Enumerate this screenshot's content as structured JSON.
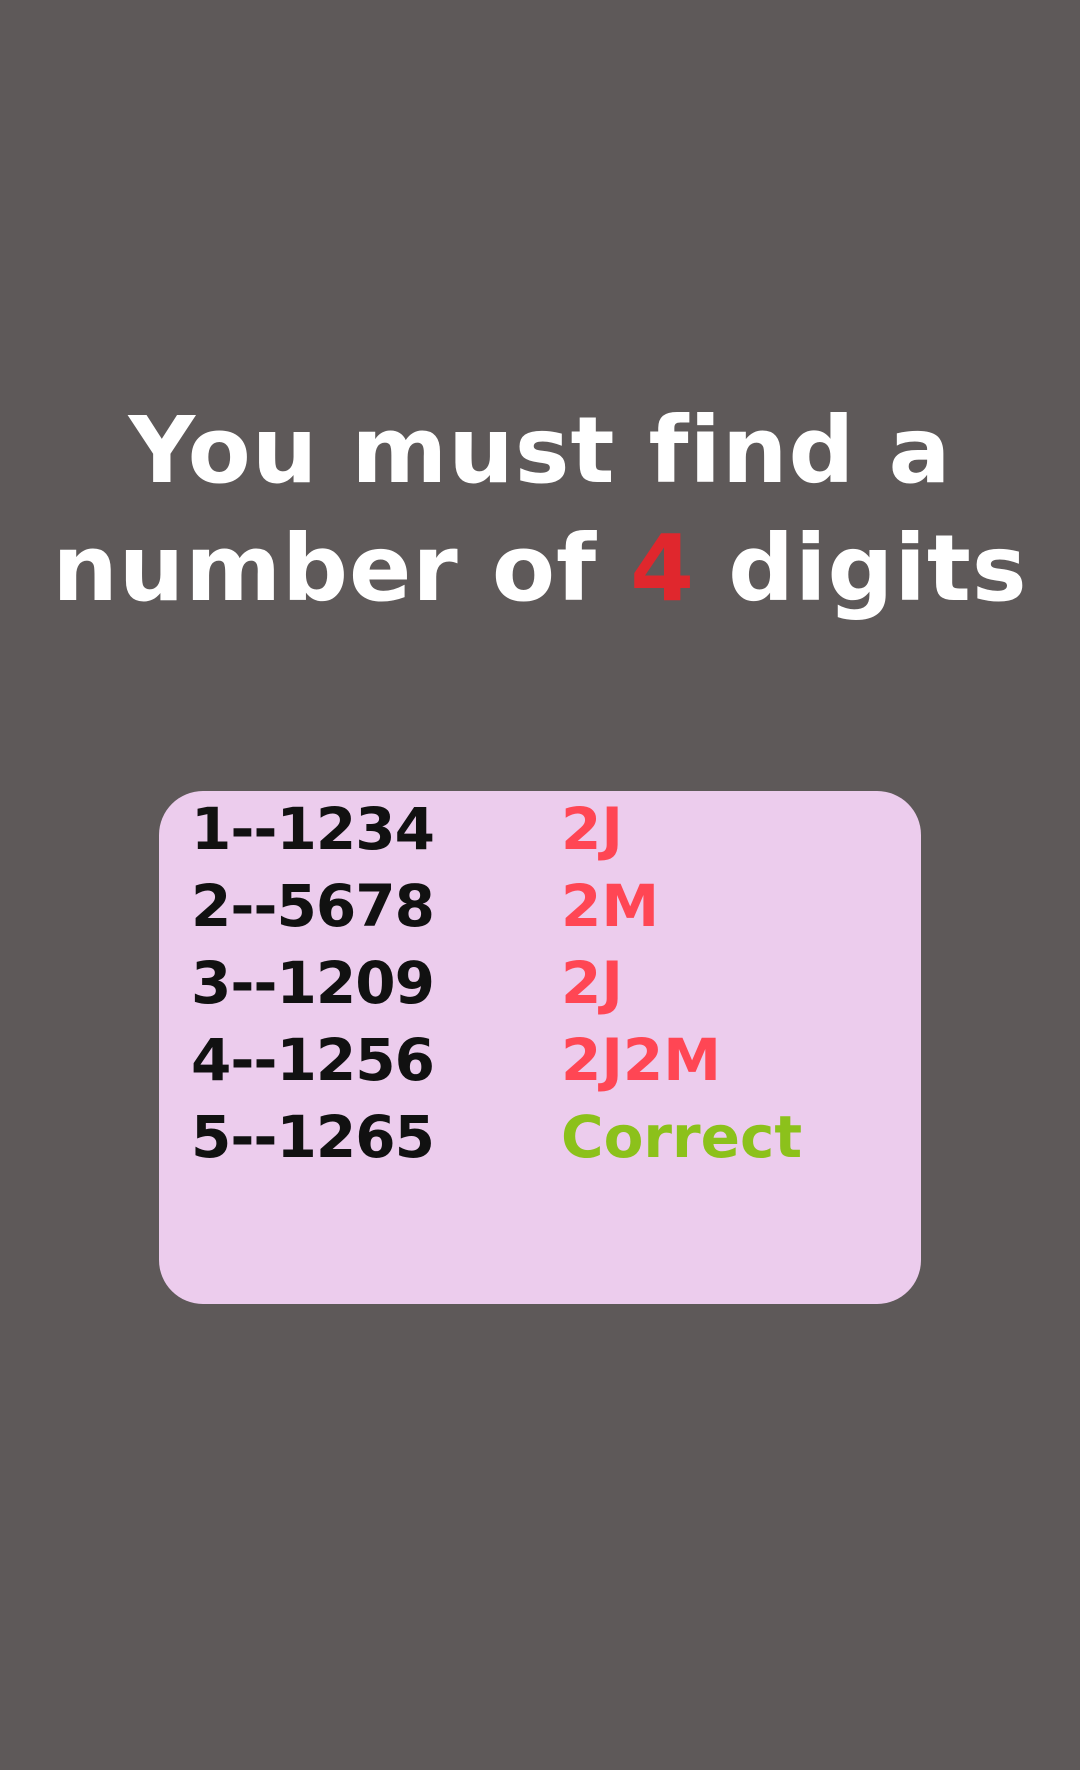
{
  "prompt": {
    "line1": "You must find a",
    "line2_before": "number of ",
    "digit_count": "4",
    "line2_after": " digits"
  },
  "attempts": [
    {
      "guess": "1--1234",
      "result": "2J"
    },
    {
      "guess": "2--5678",
      "result": "2M"
    },
    {
      "guess": "3--1209",
      "result": "2J"
    },
    {
      "guess": "4--1256",
      "result": "2J2M"
    },
    {
      "guess": "5--1265",
      "result": "Correct"
    }
  ],
  "colors": {
    "background": "#5e5959",
    "panel": "#eccced",
    "highlight": "#e0272d",
    "hint": "#ff4654",
    "correct": "#8cc11b"
  }
}
